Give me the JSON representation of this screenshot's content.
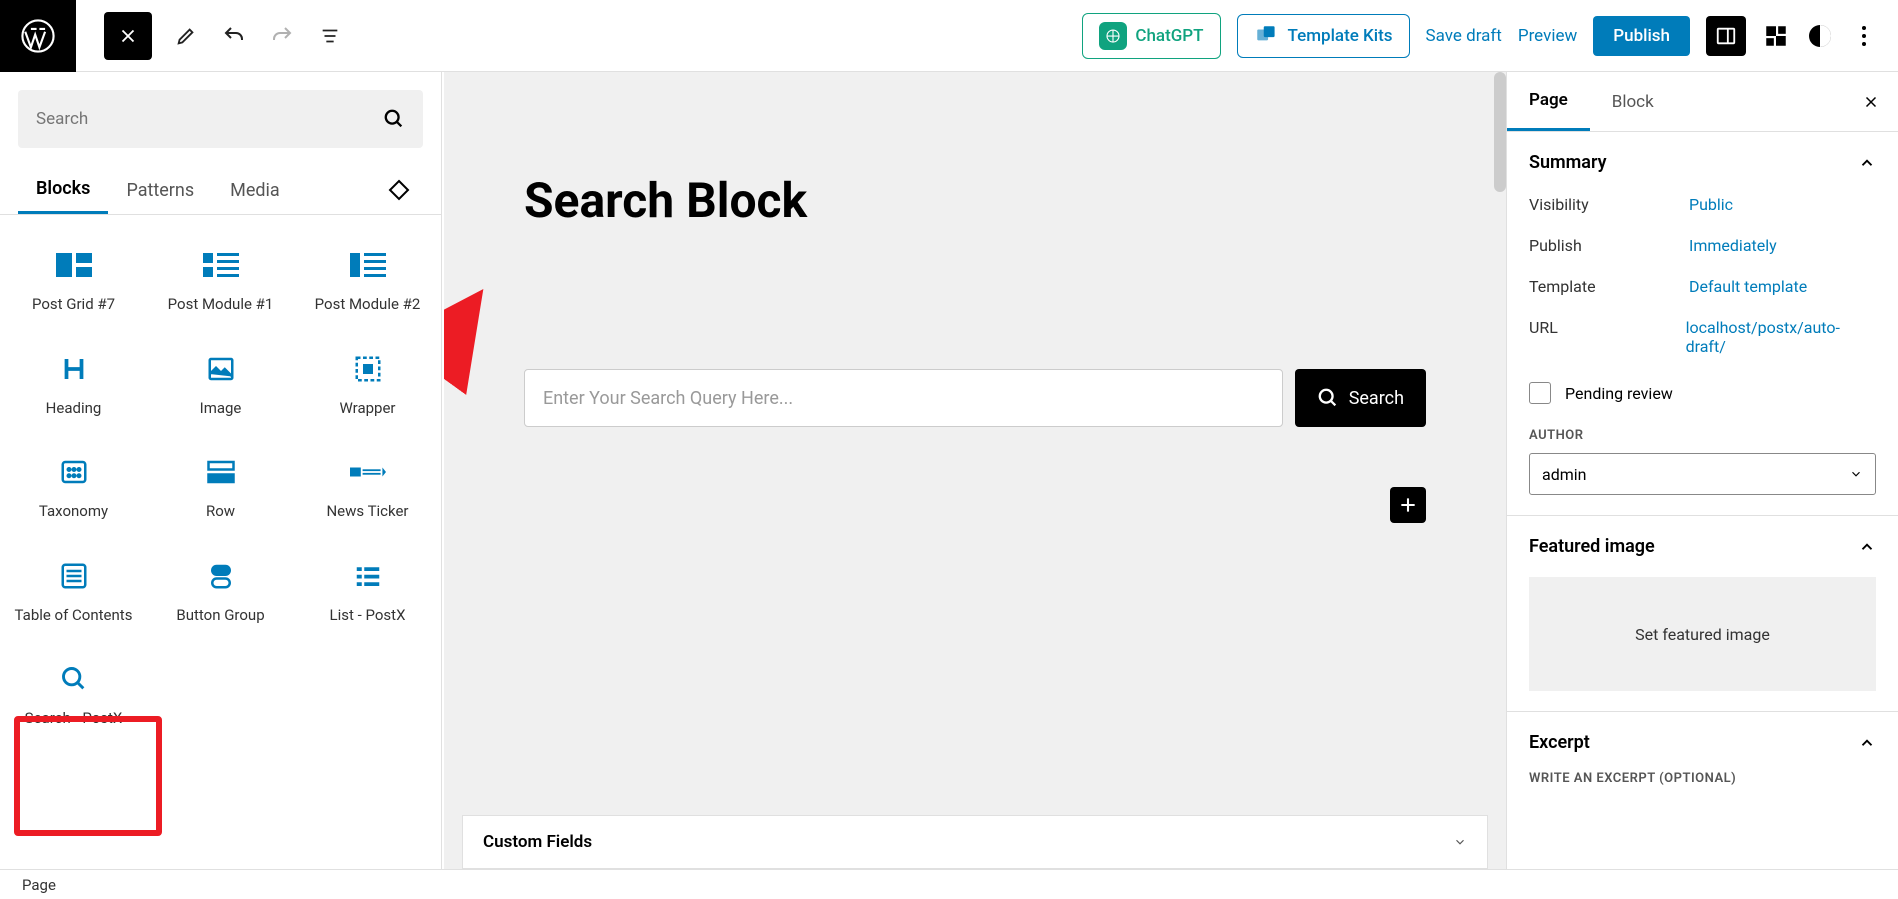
{
  "topbar": {
    "chatgpt": "ChatGPT",
    "template_kits": "Template Kits",
    "save_draft": "Save draft",
    "preview": "Preview",
    "publish": "Publish"
  },
  "left": {
    "search_placeholder": "Search",
    "tabs": {
      "blocks": "Blocks",
      "patterns": "Patterns",
      "media": "Media"
    },
    "blocks": [
      "Post Grid #7",
      "Post Module #1",
      "Post Module #2",
      "Heading",
      "Image",
      "Wrapper",
      "Taxonomy",
      "Row",
      "News Ticker",
      "Table of Contents",
      "Button Group",
      "List - PostX",
      "Search - PostX"
    ]
  },
  "canvas": {
    "title": "Search Block",
    "search_placeholder": "Enter Your Search Query Here...",
    "search_button": "Search",
    "custom_fields": "Custom Fields"
  },
  "right": {
    "tabs": {
      "page": "Page",
      "block": "Block"
    },
    "summary": {
      "title": "Summary",
      "visibility": {
        "k": "Visibility",
        "v": "Public"
      },
      "publish": {
        "k": "Publish",
        "v": "Immediately"
      },
      "template": {
        "k": "Template",
        "v": "Default template"
      },
      "url": {
        "k": "URL",
        "v": "localhost/postx/auto-draft/"
      },
      "pending": "Pending review",
      "author_label": "AUTHOR",
      "author_value": "admin"
    },
    "featured": {
      "title": "Featured image",
      "button": "Set featured image"
    },
    "excerpt": {
      "title": "Excerpt",
      "label": "WRITE AN EXCERPT (OPTIONAL)"
    }
  },
  "footer": {
    "breadcrumb": "Page"
  }
}
